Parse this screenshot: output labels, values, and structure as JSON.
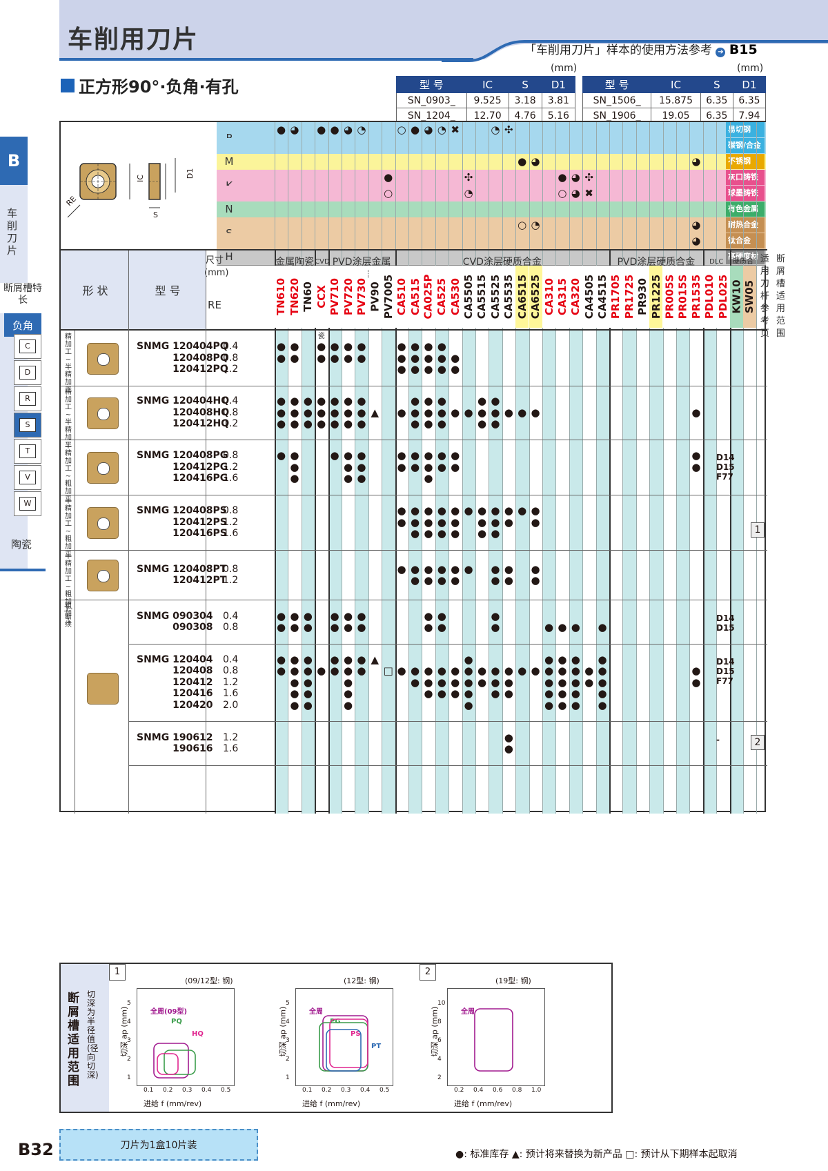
{
  "header": {
    "title": "车削用刀片",
    "ref_note": "「车削用刀片」样本的使用方法参考",
    "ref_page": "B15"
  },
  "section": {
    "title": "正方形90°·负角·有孔"
  },
  "dim_tables": {
    "unit": "(mm)",
    "headers": [
      "型 号",
      "IC",
      "S",
      "D1"
    ],
    "left": [
      [
        "SN_0903_",
        "9.525",
        "3.18",
        "3.81"
      ],
      [
        "SN_1204_",
        "12.70",
        "4.76",
        "5.16"
      ]
    ],
    "right": [
      [
        "SN_1506_",
        "15.875",
        "6.35",
        "6.35"
      ],
      [
        "SN_1906_",
        "19.05",
        "6.35",
        "7.94"
      ]
    ]
  },
  "sidebar": {
    "tab": "B",
    "label": "车削刀片",
    "chip_label": "断屑槽特长",
    "neg_label": "负角",
    "shapes": [
      "C",
      "D",
      "R",
      "S",
      "T",
      "V",
      "W"
    ],
    "ceramic": "陶瓷"
  },
  "diagram_labels": {
    "ic": "IC",
    "d1": "D1",
    "s": "S",
    "re": "RE"
  },
  "materials": [
    {
      "code": "P",
      "rows": [
        "易切钢",
        "碳钢/合金钢"
      ],
      "color": "#a6d8ee",
      "label_color": "#3bb1e0"
    },
    {
      "code": "M",
      "rows": [
        "不锈钢"
      ],
      "color": "#fbf49a",
      "label_color": "#e9a900"
    },
    {
      "code": "K",
      "rows": [
        "灰口铸铁",
        "球墨铸铁"
      ],
      "color": "#f5b8d4",
      "label_color": "#e8508d"
    },
    {
      "code": "N",
      "rows": [
        "有色金属"
      ],
      "color": "#a8dcbc",
      "label_color": "#3cad6a"
    },
    {
      "code": "S",
      "rows": [
        "耐热合金",
        "钛合金"
      ],
      "color": "#eccba4",
      "label_color": "#c58f52"
    },
    {
      "code": "H",
      "rows": [
        "高硬度材"
      ],
      "color": "#c8c8c8",
      "label_color": "#8a8a8a"
    }
  ],
  "header_labels": {
    "shape": "形 状",
    "model": "型 号",
    "size": "尺寸(mm)",
    "re": "RE",
    "groups": [
      "金属陶瓷",
      "CVD涂层金属陶瓷",
      "PVD涂层金属陶瓷",
      "CVD涂层硬质合金",
      "PVD涂层硬质合金",
      "DLC",
      "硬质合金",
      "适用刀杆参考页",
      "断屑槽适用范围"
    ]
  },
  "grades": [
    {
      "name": "TN610",
      "color": "#e60012",
      "bg": "#ffffff"
    },
    {
      "name": "TN620",
      "color": "#e60012",
      "bg": "#ffffff"
    },
    {
      "name": "TN60",
      "color": "#231815",
      "bg": "#ffffff"
    },
    {
      "name": "CCX",
      "color": "#e60012",
      "bg": "#ffffff"
    },
    {
      "name": "PV710",
      "color": "#e60012",
      "bg": "#ffffff"
    },
    {
      "name": "PV720",
      "color": "#e60012",
      "bg": "#ffffff"
    },
    {
      "name": "PV730",
      "color": "#e60012",
      "bg": "#ffffff"
    },
    {
      "name": "PV90",
      "color": "#231815",
      "bg": "#ffffff"
    },
    {
      "name": "PV7005",
      "color": "#231815",
      "bg": "#ffffff"
    },
    {
      "name": "CA510",
      "color": "#e60012",
      "bg": "#ffffff"
    },
    {
      "name": "CA515",
      "color": "#e60012",
      "bg": "#ffffff"
    },
    {
      "name": "CA025P",
      "color": "#e60012",
      "bg": "#ffffff"
    },
    {
      "name": "CA525",
      "color": "#e60012",
      "bg": "#ffffff"
    },
    {
      "name": "CA530",
      "color": "#e60012",
      "bg": "#ffffff"
    },
    {
      "name": "CA5505",
      "color": "#231815",
      "bg": "#ffffff"
    },
    {
      "name": "CA5515",
      "color": "#231815",
      "bg": "#ffffff"
    },
    {
      "name": "CA5525",
      "color": "#231815",
      "bg": "#ffffff"
    },
    {
      "name": "CA5535",
      "color": "#231815",
      "bg": "#ffffff"
    },
    {
      "name": "CA6515",
      "color": "#231815",
      "bg": "#fff799"
    },
    {
      "name": "CA6525",
      "color": "#231815",
      "bg": "#fff799"
    },
    {
      "name": "CA310",
      "color": "#e60012",
      "bg": "#ffffff"
    },
    {
      "name": "CA315",
      "color": "#e60012",
      "bg": "#ffffff"
    },
    {
      "name": "CA320",
      "color": "#e60012",
      "bg": "#ffffff"
    },
    {
      "name": "CA4505",
      "color": "#231815",
      "bg": "#ffffff"
    },
    {
      "name": "CA4515",
      "color": "#231815",
      "bg": "#ffffff"
    },
    {
      "name": "PR1705",
      "color": "#e60012",
      "bg": "#ffffff"
    },
    {
      "name": "PR1725",
      "color": "#e60012",
      "bg": "#ffffff"
    },
    {
      "name": "PR930",
      "color": "#231815",
      "bg": "#ffffff"
    },
    {
      "name": "PR1225",
      "color": "#231815",
      "bg": "#fff799"
    },
    {
      "name": "PR005S",
      "color": "#e60012",
      "bg": "#ffffff"
    },
    {
      "name": "PR015S",
      "color": "#e60012",
      "bg": "#ffffff"
    },
    {
      "name": "PR1535",
      "color": "#e60012",
      "bg": "#ffffff"
    },
    {
      "name": "PDL010",
      "color": "#e60012",
      "bg": "#ffffff"
    },
    {
      "name": "PDL025",
      "color": "#e60012",
      "bg": "#ffffff"
    },
    {
      "name": "KW10",
      "color": "#231815",
      "bg": "#a8dcbc"
    },
    {
      "name": "SW05",
      "color": "#231815",
      "bg": "#eccba4"
    }
  ],
  "recommendations": [
    {
      "row": "P1",
      "cells": {
        "0": "●",
        "1": "◕",
        "3": "●",
        "4": "●",
        "5": "◕",
        "6": "◔",
        "9": "○",
        "10": "●",
        "11": "◕",
        "12": "◔",
        "13": "✖",
        "16": "◔",
        "17": "✣"
      }
    },
    {
      "row": "M",
      "cells": {
        "18": "●",
        "19": "◕",
        "31": "◕"
      }
    },
    {
      "row": "K1",
      "cells": {
        "8": "●",
        "14": "✣",
        "21": "●",
        "22": "◕",
        "23": "✣"
      }
    },
    {
      "row": "K2",
      "cells": {
        "8": "○",
        "14": "◔",
        "21": "○",
        "22": "◕",
        "23": "✖"
      }
    },
    {
      "row": "S1",
      "cells": {
        "18": "○",
        "19": "◔",
        "31": "◕"
      }
    },
    {
      "row": "S2",
      "cells": {
        "31": "◕"
      }
    }
  ],
  "process_labels": [
    "精加工~半精加工",
    "精加工~半精加工",
    "半精加工~粗加工",
    "半精加工~粗加工",
    "半精加工~粗加工·断续",
    "粗加工"
  ],
  "products": [
    {
      "models": [
        "SNMG 120404PQ",
        "120408PQ",
        "120412PQ"
      ],
      "re": [
        "0.4",
        "0.8",
        "1.2"
      ],
      "ref": "",
      "marks": [
        [
          0,
          1,
          3,
          4,
          5,
          6,
          9,
          10,
          11,
          12
        ],
        [
          0,
          1,
          3,
          4,
          5,
          6,
          9,
          10,
          11,
          12,
          13
        ],
        [
          9,
          10,
          11,
          12,
          13
        ]
      ]
    },
    {
      "models": [
        "SNMG 120404HQ",
        "120408HQ",
        "120412HQ"
      ],
      "re": [
        "0.4",
        "0.8",
        "1.2"
      ],
      "ref": "",
      "marks": [
        [
          0,
          1,
          2,
          3,
          4,
          5,
          6,
          10,
          11,
          12,
          15,
          16
        ],
        [
          0,
          1,
          2,
          3,
          4,
          5,
          6,
          9,
          10,
          11,
          12,
          13,
          14,
          15,
          16,
          17,
          18,
          19,
          31
        ],
        [
          0,
          1,
          2,
          3,
          4,
          5,
          6,
          10,
          11,
          12,
          15,
          16
        ]
      ],
      "triangles": [
        [
          1,
          7
        ]
      ]
    },
    {
      "models": [
        "SNMG 120408PG",
        "120412PG",
        "120416PG"
      ],
      "re": [
        "0.8",
        "1.2",
        "1.6"
      ],
      "ref": "D14\nD15\nF77",
      "marks": [
        [
          0,
          1,
          4,
          5,
          6,
          9,
          10,
          11,
          12,
          13,
          31
        ],
        [
          1,
          5,
          6,
          9,
          10,
          11,
          12,
          13,
          31
        ],
        [
          1,
          5,
          6,
          11
        ]
      ]
    },
    {
      "models": [
        "SNMG 120408PS",
        "120412PS",
        "120416PS"
      ],
      "re": [
        "0.8",
        "1.2",
        "1.6"
      ],
      "ref": "",
      "marks": [
        [
          9,
          10,
          11,
          12,
          13,
          14,
          15,
          16,
          17,
          18,
          19
        ],
        [
          9,
          10,
          11,
          12,
          13,
          15,
          16,
          17,
          19
        ],
        [
          10,
          11,
          12,
          13,
          15,
          16
        ]
      ]
    },
    {
      "models": [
        "SNMG 120408PT",
        "120412PT"
      ],
      "re": [
        "0.8",
        "1.2"
      ],
      "ref": "",
      "marks": [
        [
          9,
          10,
          11,
          12,
          13,
          14,
          16,
          17,
          19
        ],
        [
          10,
          11,
          12,
          13,
          16,
          17,
          19
        ]
      ]
    },
    {
      "models": [
        "SNMG 090304",
        "090308"
      ],
      "re": [
        "0.4",
        "0.8"
      ],
      "ref": "D14\nD15",
      "marks": [
        [
          0,
          1,
          2,
          4,
          5,
          6,
          11,
          12,
          16
        ],
        [
          0,
          1,
          2,
          4,
          5,
          6,
          11,
          12,
          16,
          20,
          21,
          22,
          24
        ]
      ]
    },
    {
      "models": [
        "SNMG 120404",
        "120408",
        "120412",
        "120416",
        "120420"
      ],
      "re": [
        "0.4",
        "0.8",
        "1.2",
        "1.6",
        "2.0"
      ],
      "ref": "D14\nD15\nF77",
      "marks": [
        [
          0,
          1,
          2,
          4,
          5,
          6,
          14,
          20,
          21,
          22,
          24
        ],
        [
          0,
          1,
          2,
          3,
          4,
          5,
          6,
          9,
          10,
          11,
          12,
          13,
          14,
          15,
          16,
          17,
          18,
          19,
          20,
          21,
          22,
          23,
          24,
          31
        ],
        [
          1,
          2,
          5,
          10,
          11,
          12,
          13,
          14,
          15,
          16,
          17,
          20,
          21,
          22,
          23,
          24,
          31
        ],
        [
          1,
          2,
          5,
          11,
          12,
          13,
          14,
          16,
          17,
          20,
          21,
          22,
          24
        ],
        [
          1,
          2,
          5,
          14,
          20,
          21,
          22,
          24
        ]
      ],
      "triangles": [
        [
          0,
          7
        ]
      ],
      "squares": [
        [
          1,
          8
        ]
      ]
    },
    {
      "models": [
        "SNMG 190612",
        "190616"
      ],
      "re": [
        "1.2",
        "1.6"
      ],
      "ref": "-",
      "marks": [
        [
          17
        ],
        [
          17
        ]
      ]
    }
  ],
  "range_tags": [
    "1",
    "2"
  ],
  "chip_range": {
    "title": "断屑槽适用范围",
    "side_note": "切深为半径值(径向切深)",
    "panels": [
      {
        "tag": "1",
        "subtitle": "(09/12型: 钢)",
        "xlabel": "进给 f (mm/rev)",
        "ylabel": "切深 ap (mm)",
        "xticks": [
          "0.1",
          "0.2",
          "0.3",
          "0.4",
          "0.5"
        ],
        "yticks": [
          "1",
          "2",
          "3",
          "4",
          "5"
        ],
        "labels": [
          "全周(09型)",
          "PQ",
          "HQ"
        ]
      },
      {
        "tag": "",
        "subtitle": "(12型: 钢)",
        "xlabel": "进给 f (mm/rev)",
        "ylabel": "切深 ap (mm)",
        "xticks": [
          "0.1",
          "0.2",
          "0.3",
          "0.4",
          "0.5"
        ],
        "yticks": [
          "1",
          "2",
          "3",
          "4",
          "5"
        ],
        "labels": [
          "全周",
          "PG",
          "PS",
          "PT"
        ]
      },
      {
        "tag": "2",
        "subtitle": "(19型: 钢)",
        "xlabel": "进给 f (mm/rev)",
        "ylabel": "切深 ap (mm)",
        "xticks": [
          "0.2",
          "0.4",
          "0.6",
          "0.8",
          "1.0"
        ],
        "yticks": [
          "2",
          "4",
          "6",
          "8",
          "10"
        ],
        "labels": [
          "全周"
        ]
      }
    ]
  },
  "footer": {
    "box": "刀片为1盒10片装",
    "page": "B32",
    "legend": "●: 标准库存   ▲: 预计将来替换为新产品   □: 预计从下期样本起取消"
  }
}
